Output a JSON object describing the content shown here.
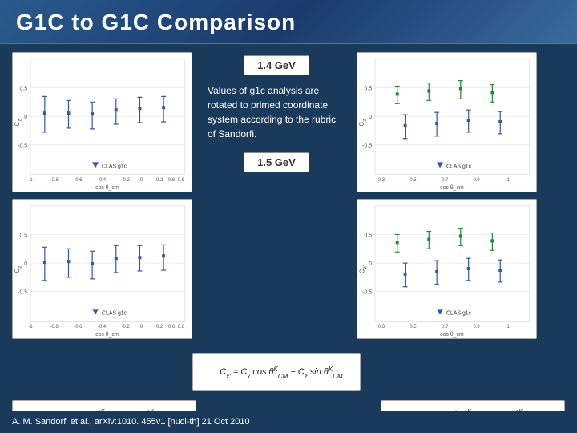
{
  "header": {
    "title": "G1C to G1C Comparison"
  },
  "center": {
    "badge_top": "1.4 GeV",
    "badge_bottom": "1.5 GeV",
    "description": "Values of g1c analysis are rotated to primed coordinate system according to the rubric of Sandorfi."
  },
  "footer": {
    "citation": "A. M. Sandorfi et al., arXiv:1010. 455v1 [nucl-th] 21 Oct 2010"
  },
  "plots": {
    "left_top_label": "CLAS g1c",
    "left_bottom_label": "CLAS g1c",
    "right_top_label": "CLAS g1c",
    "right_bottom_label": "CLAS g1c"
  },
  "formula_top": "Cx' = Cx cosθᴷCM − Cz sinθᴷCM",
  "formula_bottom": "Cz' = Cx sinθᴷCM + Cz cosθᴷCM"
}
